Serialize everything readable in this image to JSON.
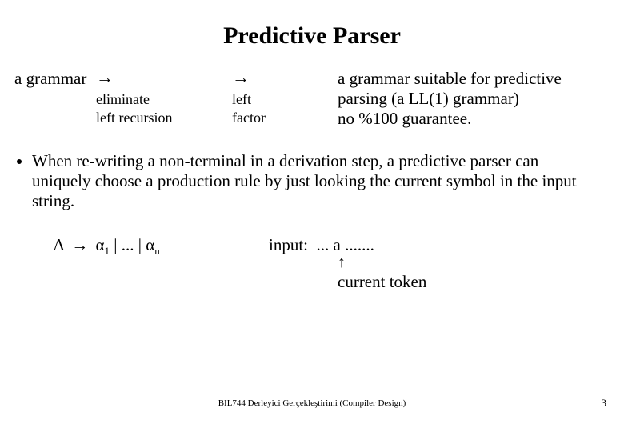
{
  "title": "Predictive Parser",
  "pipeline": {
    "start": "a grammar",
    "arrow": "→",
    "step1": {
      "line1": "eliminate",
      "line2": "left recursion"
    },
    "step2": {
      "line1": "left",
      "line2": "factor"
    },
    "result": {
      "line1": "a grammar suitable for predictive",
      "line2": "parsing (a LL(1) grammar)",
      "line3": "no %100 guarantee."
    }
  },
  "bullet": "When re-writing a non-terminal in a derivation step, a predictive parser can uniquely choose a production rule by just looking the current symbol in the input string.",
  "rule": {
    "lhs": "A",
    "to": "→",
    "alpha": "α",
    "sub1": "1",
    "mid": " | ... | ",
    "subn": "n",
    "input_label": "input:",
    "input_rest": "  ... a .......",
    "arrow_up": "↑",
    "current_token": "current token"
  },
  "footer": "BIL744 Derleyici Gerçekleştirimi (Compiler Design)",
  "page": "3"
}
